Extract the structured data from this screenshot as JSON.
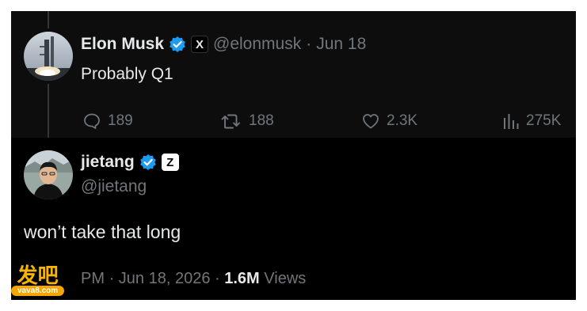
{
  "parent_tweet": {
    "display_name": "Elon Musk",
    "handle": "@elonmusk",
    "separator": "·",
    "date": "Jun 18",
    "text": "Probably Q1",
    "affiliate_badge": "X",
    "actions": {
      "replies": "189",
      "reposts": "188",
      "likes": "2.3K",
      "views": "275K"
    }
  },
  "main_tweet": {
    "display_name": "jietang",
    "handle": "@jietang",
    "affiliate_badge": "Z",
    "text": "won’t take that long",
    "meta": {
      "time": "PM",
      "separator": "·",
      "date": "Jun 18, 2026",
      "views_count": "1.6M",
      "views_label": "Views"
    }
  },
  "watermark": {
    "chars": "发吧",
    "site": "vava8.com"
  },
  "colors": {
    "background": "#000000",
    "parent_background": "#0d0d0d",
    "text_primary": "#e7e9ea",
    "text_muted": "#71767b",
    "verified_blue": "#1d9bf0",
    "watermark_gold": "#f7b500"
  },
  "icons": [
    "verified-badge-icon",
    "reply-icon",
    "repost-icon",
    "like-icon",
    "views-icon"
  ]
}
